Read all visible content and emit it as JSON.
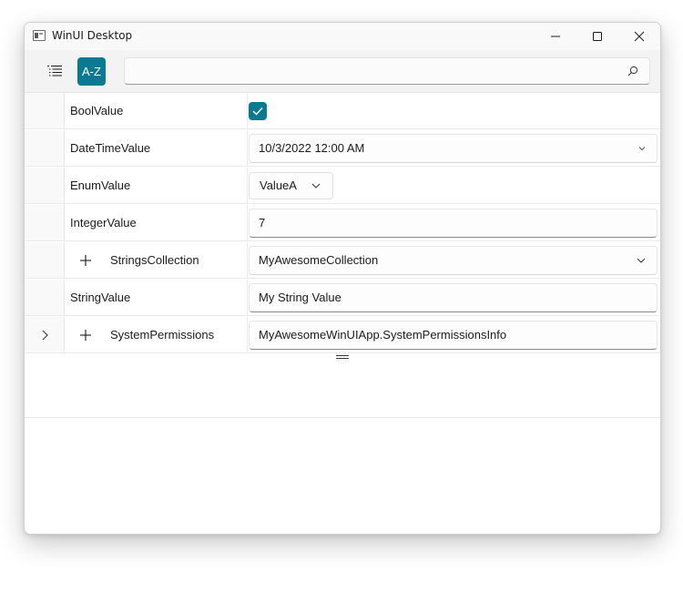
{
  "window": {
    "title": "WinUI Desktop",
    "accent": "#0a7a93"
  },
  "titlebar": {
    "icons": [
      "app-icon",
      "minimize-icon",
      "maximize-icon",
      "close-icon"
    ]
  },
  "toolbar": {
    "categorized_icon": "list-icon",
    "alphabetical_label": "A-Z",
    "search": {
      "value": "",
      "placeholder": "",
      "icon": "search-icon"
    }
  },
  "properties": [
    {
      "name": "BoolValue",
      "editor": "checkbox",
      "checked": true
    },
    {
      "name": "DateTimeValue",
      "editor": "datetime",
      "value": "10/3/2022 12:00 AM"
    },
    {
      "name": "EnumValue",
      "editor": "enum",
      "value": "ValueA"
    },
    {
      "name": "IntegerValue",
      "editor": "text",
      "value": "7"
    },
    {
      "name": "StringsCollection",
      "editor": "collection",
      "value": "MyAwesomeCollection"
    },
    {
      "name": "StringValue",
      "editor": "text",
      "value": "My String Value"
    },
    {
      "name": "SystemPermissions",
      "editor": "object",
      "value": "MyAwesomeWinUIApp.SystemPermissionsInfo"
    }
  ]
}
